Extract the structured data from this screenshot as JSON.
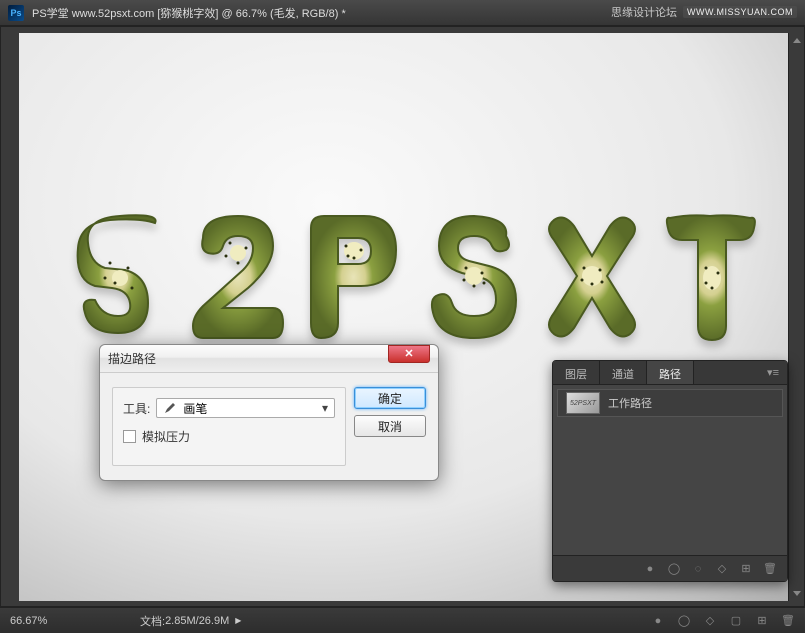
{
  "titlebar": {
    "app_badge": "Ps",
    "title": "PS学堂 www.52psxt.com [猕猴桃字效] @ 66.7% (毛发, RGB/8) *"
  },
  "watermark": {
    "text": "思缘设计论坛",
    "badge": "WWW.MISSYUAN.COM"
  },
  "canvas": {
    "display_text": "52PSXT"
  },
  "dialog": {
    "title": "描边路径",
    "tool_label": "工具:",
    "tool_value": "画笔",
    "simulate_pressure_label": "模拟压力",
    "ok": "确定",
    "cancel": "取消"
  },
  "panel": {
    "tabs": {
      "layers": "图层",
      "channels": "通道",
      "paths": "路径"
    },
    "path_item_label": "工作路径"
  },
  "statusbar": {
    "zoom": "66.67%",
    "doc_label": "文档:",
    "doc_value": "2.85M/26.9M"
  }
}
